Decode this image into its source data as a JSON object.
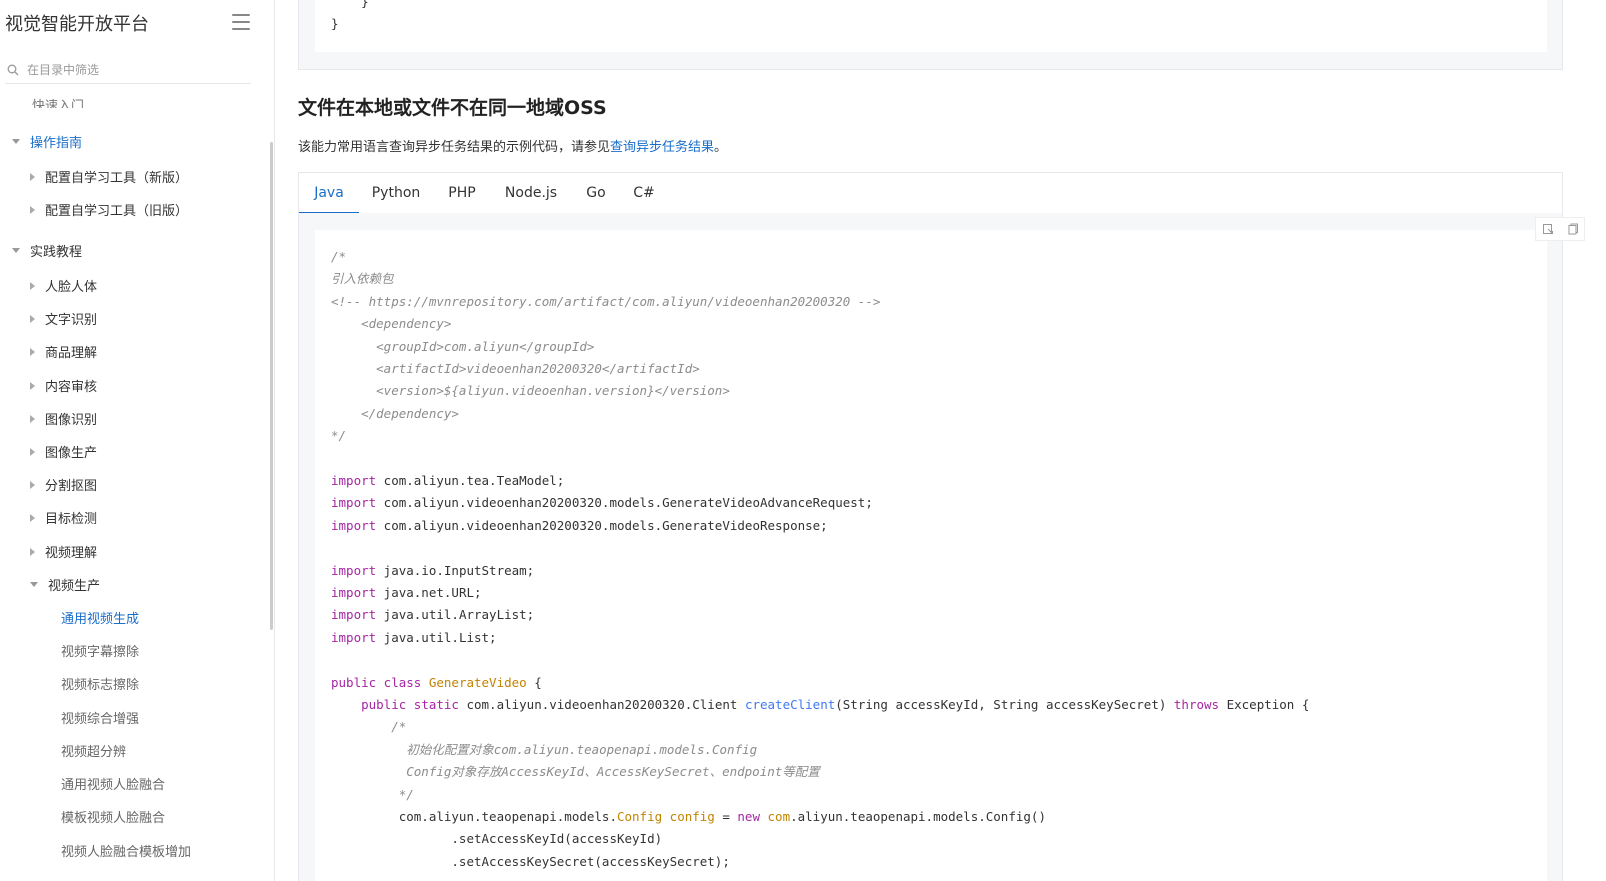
{
  "sidebar": {
    "brand": "视觉智能开放平台",
    "filter_placeholder": "在目录中筛选",
    "clipped_item": "快速入门",
    "items": [
      {
        "label": "操作指南",
        "level": 0,
        "expanded": true,
        "active": true
      },
      {
        "label": "配置自学习工具（新版）",
        "level": 1,
        "expanded": false
      },
      {
        "label": "配置自学习工具（旧版）",
        "level": 1,
        "expanded": false
      },
      {
        "label": "实践教程",
        "level": 0,
        "expanded": true
      },
      {
        "label": "人脸人体",
        "level": 1,
        "expanded": false
      },
      {
        "label": "文字识别",
        "level": 1,
        "expanded": false
      },
      {
        "label": "商品理解",
        "level": 1,
        "expanded": false
      },
      {
        "label": "内容审核",
        "level": 1,
        "expanded": false
      },
      {
        "label": "图像识别",
        "level": 1,
        "expanded": false
      },
      {
        "label": "图像生产",
        "level": 1,
        "expanded": false
      },
      {
        "label": "分割抠图",
        "level": 1,
        "expanded": false
      },
      {
        "label": "目标检测",
        "level": 1,
        "expanded": false
      },
      {
        "label": "视频理解",
        "level": 1,
        "expanded": false
      },
      {
        "label": "视频生产",
        "level": 1,
        "expanded": true
      },
      {
        "label": "通用视频生成",
        "level": 2,
        "active": true
      },
      {
        "label": "视频字幕擦除",
        "level": 2
      },
      {
        "label": "视频标志擦除",
        "level": 2
      },
      {
        "label": "视频综合增强",
        "level": 2
      },
      {
        "label": "视频超分辨",
        "level": 2
      },
      {
        "label": "通用视频人脸融合",
        "level": 2
      },
      {
        "label": "模板视频人脸融合",
        "level": 2
      },
      {
        "label": "视频人脸融合模板增加",
        "level": 2
      }
    ]
  },
  "top_code": {
    "line1": "    }",
    "line2": "}"
  },
  "section": {
    "heading": "文件在本地或文件不在同一地域OSS",
    "desc_prefix": "该能力常用语言查询异步任务结果的示例代码，请参见",
    "desc_link": "查询异步任务结果",
    "desc_suffix": "。"
  },
  "tabs": [
    "Java",
    "Python",
    "PHP",
    "Node.js",
    "Go",
    "C#"
  ],
  "active_tab": "Java",
  "code": [
    [
      [
        "cm",
        "/*"
      ]
    ],
    [
      [
        "cm",
        "引入依赖包"
      ]
    ],
    [
      [
        "cm",
        "<!-- https://mvnrepository.com/artifact/com.aliyun/videoenhan20200320 -->"
      ]
    ],
    [
      [
        "cm",
        "    <dependency>"
      ]
    ],
    [
      [
        "cm",
        "      <groupId>com.aliyun</groupId>"
      ]
    ],
    [
      [
        "cm",
        "      <artifactId>videoenhan20200320</artifactId>"
      ]
    ],
    [
      [
        "cm",
        "      <version>${aliyun.videoenhan.version}</version>"
      ]
    ],
    [
      [
        "cm",
        "    </dependency>"
      ]
    ],
    [
      [
        "cm",
        "*/"
      ]
    ],
    [],
    [
      [
        "kw",
        "import"
      ],
      [
        "",
        " com.aliyun.tea.TeaModel;"
      ]
    ],
    [
      [
        "kw",
        "import"
      ],
      [
        "",
        " com.aliyun.videoenhan20200320.models.GenerateVideoAdvanceRequest;"
      ]
    ],
    [
      [
        "kw",
        "import"
      ],
      [
        "",
        " com.aliyun.videoenhan20200320.models.GenerateVideoResponse;"
      ]
    ],
    [],
    [
      [
        "kw",
        "import"
      ],
      [
        "",
        " java.io.InputStream;"
      ]
    ],
    [
      [
        "kw",
        "import"
      ],
      [
        "",
        " java.net.URL;"
      ]
    ],
    [
      [
        "kw",
        "import"
      ],
      [
        "",
        " java.util.ArrayList;"
      ]
    ],
    [
      [
        "kw",
        "import"
      ],
      [
        "",
        " java.util.List;"
      ]
    ],
    [],
    [
      [
        "kw",
        "public class"
      ],
      [
        "",
        " "
      ],
      [
        "ty",
        "GenerateVideo"
      ],
      [
        "",
        " {"
      ]
    ],
    [
      [
        "",
        "    "
      ],
      [
        "kw",
        "public static"
      ],
      [
        "",
        " com.aliyun.videoenhan20200320.Client "
      ],
      [
        "fn",
        "createClient"
      ],
      [
        "",
        "(String accessKeyId, String accessKeySecret) "
      ],
      [
        "kw",
        "throws"
      ],
      [
        "",
        " Exception {"
      ]
    ],
    [
      [
        "cm",
        "        /*"
      ]
    ],
    [
      [
        "cm",
        "          初始化配置对象com.aliyun.teaopenapi.models.Config"
      ]
    ],
    [
      [
        "cm",
        "          Config对象存放AccessKeyId、AccessKeySecret、endpoint等配置"
      ]
    ],
    [
      [
        "cm",
        "         */"
      ]
    ],
    [
      [
        "",
        "         com.aliyun.teaopenapi.models."
      ],
      [
        "ty",
        "Config"
      ],
      [
        "",
        " "
      ],
      [
        "ty",
        "config"
      ],
      [
        "",
        " = "
      ],
      [
        "kw",
        "new"
      ],
      [
        "",
        " "
      ],
      [
        "ty",
        "com"
      ],
      [
        "",
        ".aliyun.teaopenapi.models.Config()"
      ]
    ],
    [
      [
        "",
        "                .setAccessKeyId(accessKeyId)"
      ]
    ],
    [
      [
        "",
        "                .setAccessKeySecret(accessKeySecret);"
      ]
    ]
  ]
}
